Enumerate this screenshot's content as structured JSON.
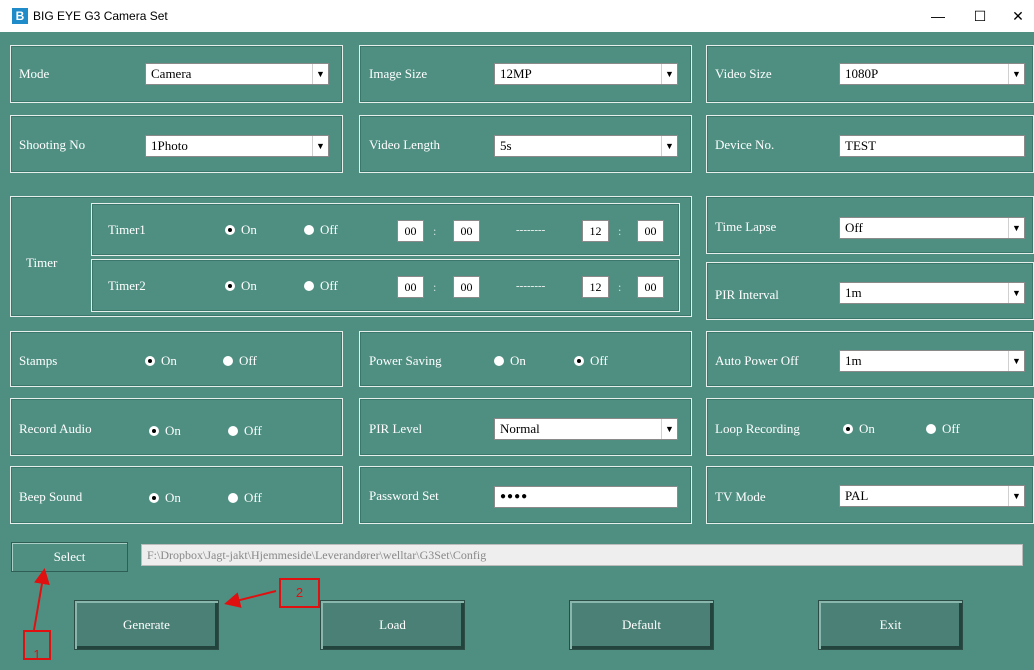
{
  "window": {
    "logo_letter": "B",
    "title": "BIG EYE G3 Camera Set",
    "minimize": "—",
    "maximize": "☐",
    "close": "✕"
  },
  "mode": {
    "label": "Mode",
    "value": "Camera"
  },
  "image_size": {
    "label": "Image Size",
    "value": "12MP"
  },
  "video_size": {
    "label": "Video Size",
    "value": "1080P"
  },
  "shooting_no": {
    "label": "Shooting No",
    "value": "1Photo"
  },
  "video_length": {
    "label": "Video Length",
    "value": "5s"
  },
  "device_no": {
    "label": "Device No.",
    "value": "TEST"
  },
  "timer": {
    "label": "Timer",
    "on_label": "On",
    "off_label": "Off",
    "dashes": "--------",
    "rows": [
      {
        "name": "Timer1",
        "selected": "On",
        "start_h": "00",
        "start_m": "00",
        "end_h": "12",
        "end_m": "00"
      },
      {
        "name": "Timer2",
        "selected": "On",
        "start_h": "00",
        "start_m": "00",
        "end_h": "12",
        "end_m": "00"
      }
    ]
  },
  "time_lapse": {
    "label": "Time Lapse",
    "value": "Off"
  },
  "pir_interval": {
    "label": "PIR Interval",
    "value": "1m"
  },
  "stamps": {
    "label": "Stamps",
    "on": "On",
    "off": "Off",
    "selected": "On"
  },
  "power_saving": {
    "label": "Power Saving",
    "on": "On",
    "off": "Off",
    "selected": "Off"
  },
  "auto_power_off": {
    "label": "Auto Power Off",
    "value": "1m"
  },
  "record_audio": {
    "label": "Record Audio",
    "on": "On",
    "off": "Off",
    "selected": "On"
  },
  "pir_level": {
    "label": "PIR Level",
    "value": "Normal"
  },
  "loop_recording": {
    "label": "Loop Recording",
    "on": "On",
    "off": "Off",
    "selected": "On"
  },
  "beep_sound": {
    "label": "Beep Sound",
    "on": "On",
    "off": "Off",
    "selected": "On"
  },
  "password_set": {
    "label": "Password Set",
    "value": "●●●●"
  },
  "tv_mode": {
    "label": "TV Mode",
    "value": "PAL"
  },
  "select": {
    "label": "Select",
    "path": "F:\\Dropbox\\Jagt-jakt\\Hjemmeside\\Leverandører\\welltar\\G3Set\\Config"
  },
  "buttons": {
    "generate": "Generate",
    "load": "Load",
    "default": "Default",
    "exit": "Exit"
  },
  "annotations": {
    "marker1": "1",
    "marker2": "2"
  },
  "colors": {
    "background": "#4f8f82",
    "annotation": "#e01010"
  }
}
